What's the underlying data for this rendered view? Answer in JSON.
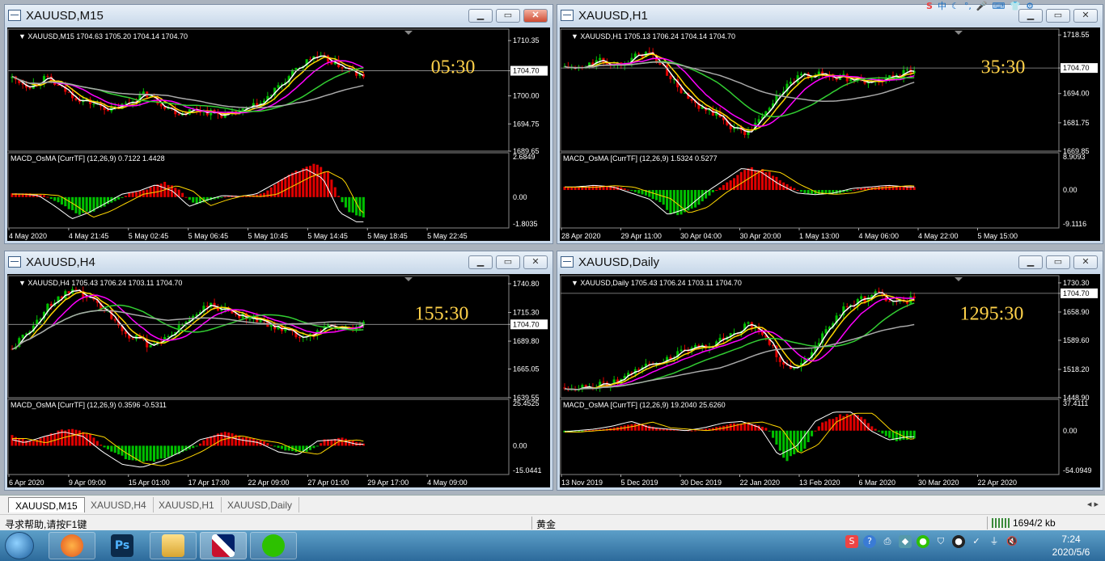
{
  "charts": [
    {
      "id": "m15",
      "window_title": "XAUUSD,M15",
      "header": "XAUUSD,M15  1704.63 1705.20 1704.14 1704.70",
      "price_ticks": [
        "1710.35",
        "1704.70",
        "1700.00",
        "1694.75",
        "1689.65"
      ],
      "current_price": "1704.70",
      "timer": "05:30",
      "macd_label": "MACD_OsMA [CurrTF] (12,26,9) 0.7122 1.4428",
      "macd_ticks": [
        "2.6849",
        "0.00",
        "-1.8035"
      ],
      "time_labels": [
        "4 May 2020",
        "4 May 21:45",
        "5 May 02:45",
        "5 May 06:45",
        "5 May 10:45",
        "5 May 14:45",
        "5 May 18:45",
        "5 May 22:45"
      ],
      "price_range": [
        1689.65,
        1712.5
      ],
      "macd_range": [
        -1.8035,
        2.6849
      ],
      "macd_zero": 0
    },
    {
      "id": "h1",
      "window_title": "XAUUSD,H1",
      "header": "XAUUSD,H1  1705.13 1706.24 1704.14 1704.70",
      "price_ticks": [
        "1718.55",
        "1704.70",
        "1694.00",
        "1681.75",
        "1669.85"
      ],
      "current_price": "1704.70",
      "timer": "35:30",
      "macd_label": "MACD_OsMA [CurrTF] (12,26,9) 1.5324 0.5277",
      "macd_ticks": [
        "8.9093",
        "0.00",
        "-9.1116"
      ],
      "time_labels": [
        "28 Apr 2020",
        "29 Apr 11:00",
        "30 Apr 04:00",
        "30 Apr 20:00",
        "1 May 13:00",
        "4 May 06:00",
        "4 May 22:00",
        "5 May 15:00"
      ],
      "price_range": [
        1669.85,
        1721.0
      ],
      "macd_range": [
        -9.1116,
        8.9093
      ],
      "macd_zero": 0
    },
    {
      "id": "h4",
      "window_title": "XAUUSD,H4",
      "header": "XAUUSD,H4  1705.43 1706.24 1703.11 1704.70",
      "price_ticks": [
        "1740.80",
        "1715.30",
        "1704.70",
        "1689.80",
        "1665.05",
        "1639.55"
      ],
      "current_price": "1704.70",
      "timer": "155:30",
      "macd_label": "MACD_OsMA [CurrTF] (12,26,9) 0.3596 -0.5311",
      "macd_ticks": [
        "25.4525",
        "0.00",
        "-15.0441"
      ],
      "time_labels": [
        "6 Apr 2020",
        "9 Apr 09:00",
        "15 Apr 01:00",
        "17 Apr 17:00",
        "22 Apr 09:00",
        "27 Apr 01:00",
        "29 Apr 17:00",
        "4 May 09:00"
      ],
      "price_range": [
        1639.55,
        1748.0
      ],
      "macd_range": [
        -15.0441,
        25.4525
      ],
      "macd_zero": 0
    },
    {
      "id": "daily",
      "window_title": "XAUUSD,Daily",
      "header": "XAUUSD,Daily  1705.43 1706.24 1703.11 1704.70",
      "price_ticks": [
        "1730.30",
        "1704.70",
        "1658.90",
        "1589.60",
        "1518.20",
        "1448.90"
      ],
      "current_price": "1704.70",
      "timer": "1295:30",
      "macd_label": "MACD_OsMA [CurrTF] (12,26,9) 19.2040 25.6260",
      "macd_ticks": [
        "37.4111",
        "0.00",
        "-54.0949"
      ],
      "time_labels": [
        "13 Nov 2019",
        "5 Dec 2019",
        "30 Dec 2019",
        "22 Jan 2020",
        "13 Feb 2020",
        "6 Mar 2020",
        "30 Mar 2020",
        "22 Apr 2020"
      ],
      "price_range": [
        1448.9,
        1748.0
      ],
      "macd_range": [
        -54.0949,
        37.4111
      ],
      "macd_zero": 0
    }
  ],
  "tabs": [
    "XAUUSD,M15",
    "XAUUSD,H4",
    "XAUUSD,H1",
    "XAUUSD,Daily"
  ],
  "tab_nav": "◂ ▸",
  "status": {
    "help": "寻求帮助,请按F1键",
    "symbol": "黄金",
    "connection": "1694/2 kb"
  },
  "clock": {
    "time": "7:24",
    "date": "2020/5/6"
  },
  "taskbar_apps": [
    {
      "name": "firefox",
      "glyph": ""
    },
    {
      "name": "photoshop",
      "glyph": "Ps"
    },
    {
      "name": "file-explorer",
      "glyph": ""
    },
    {
      "name": "metatrader",
      "glyph": ""
    },
    {
      "name": "wechat",
      "glyph": ""
    }
  ],
  "colors": {
    "bull": "#00c000",
    "bear": "#e00000",
    "ma_white": "#ffffff",
    "ma_yellow": "#ffd700",
    "ma_magenta": "#ff00ff",
    "ma_green": "#32cd32",
    "ma_gray": "#a9a9a9",
    "timer": "#ffd24a",
    "axis_text": "#ffffff"
  }
}
